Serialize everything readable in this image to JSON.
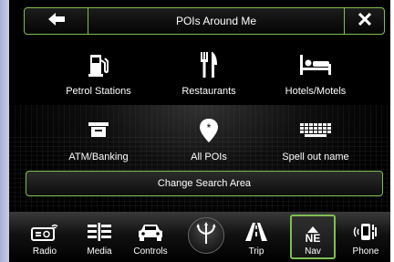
{
  "header": {
    "title": "POIs Around Me",
    "back_icon": "arrow-left-icon",
    "close_icon": "close-icon"
  },
  "pois": [
    {
      "label": "Petrol Stations",
      "icon": "fuel-pump-icon"
    },
    {
      "label": "Restaurants",
      "icon": "fork-knife-icon"
    },
    {
      "label": "Hotels/Motels",
      "icon": "bed-icon"
    },
    {
      "label": "ATM/Banking",
      "icon": "atm-icon"
    },
    {
      "label": "All POIs",
      "icon": "map-pin-star-icon"
    },
    {
      "label": "Spell out name",
      "icon": "keyboard-icon"
    }
  ],
  "change_search_area": {
    "label": "Change Search Area"
  },
  "nav": {
    "items": [
      {
        "label": "Radio",
        "icon": "radio-icon"
      },
      {
        "label": "Media",
        "icon": "media-icon"
      },
      {
        "label": "Controls",
        "icon": "car-icon"
      },
      {
        "label": "Trip",
        "icon": "road-icon"
      },
      {
        "label": "Nav",
        "icon": "compass-icon",
        "heading": "NE",
        "active": true
      },
      {
        "label": "Phone",
        "icon": "phone-icon"
      }
    ],
    "logo_icon": "trident-logo-icon"
  },
  "colors": {
    "accent": "#7fbf52",
    "background": "#000000",
    "text": "#ffffff"
  }
}
